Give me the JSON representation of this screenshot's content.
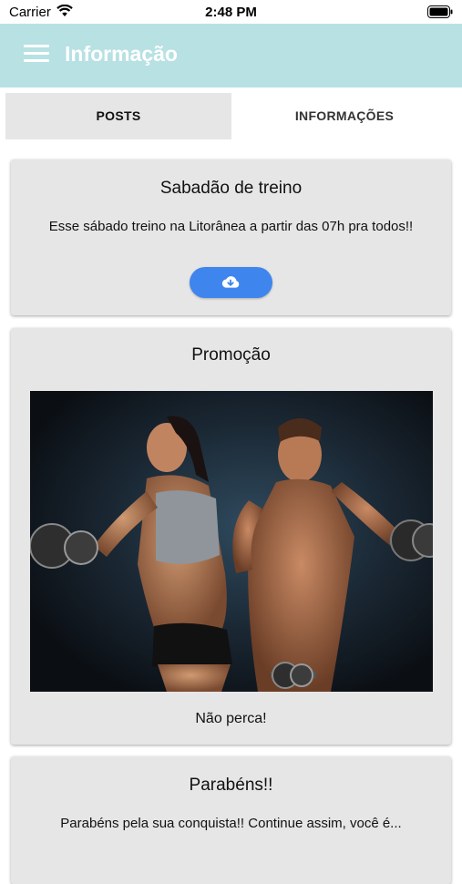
{
  "status_bar": {
    "carrier": "Carrier",
    "time": "2:48 PM"
  },
  "app_bar": {
    "title": "Informação",
    "background": "#b7e1e3"
  },
  "tabs": [
    {
      "label": "POSTS",
      "selected": true
    },
    {
      "label": "INFORMAÇÕES",
      "selected": false
    }
  ],
  "posts": [
    {
      "title": "Sabadão de treino",
      "text": "Esse sábado treino na Litorânea a partir das 07h pra todos!!",
      "action_icon": "cloud-download-icon"
    },
    {
      "title": "Promoção",
      "image": "fitness-couple-dumbbells-photo",
      "caption": "Não perca!"
    },
    {
      "title": "Parabéns!!",
      "text": "Parabéns pela sua conquista!! Continue assim, você é..."
    }
  ],
  "colors": {
    "accent": "#3f85ee",
    "card": "#e6e6e6"
  }
}
